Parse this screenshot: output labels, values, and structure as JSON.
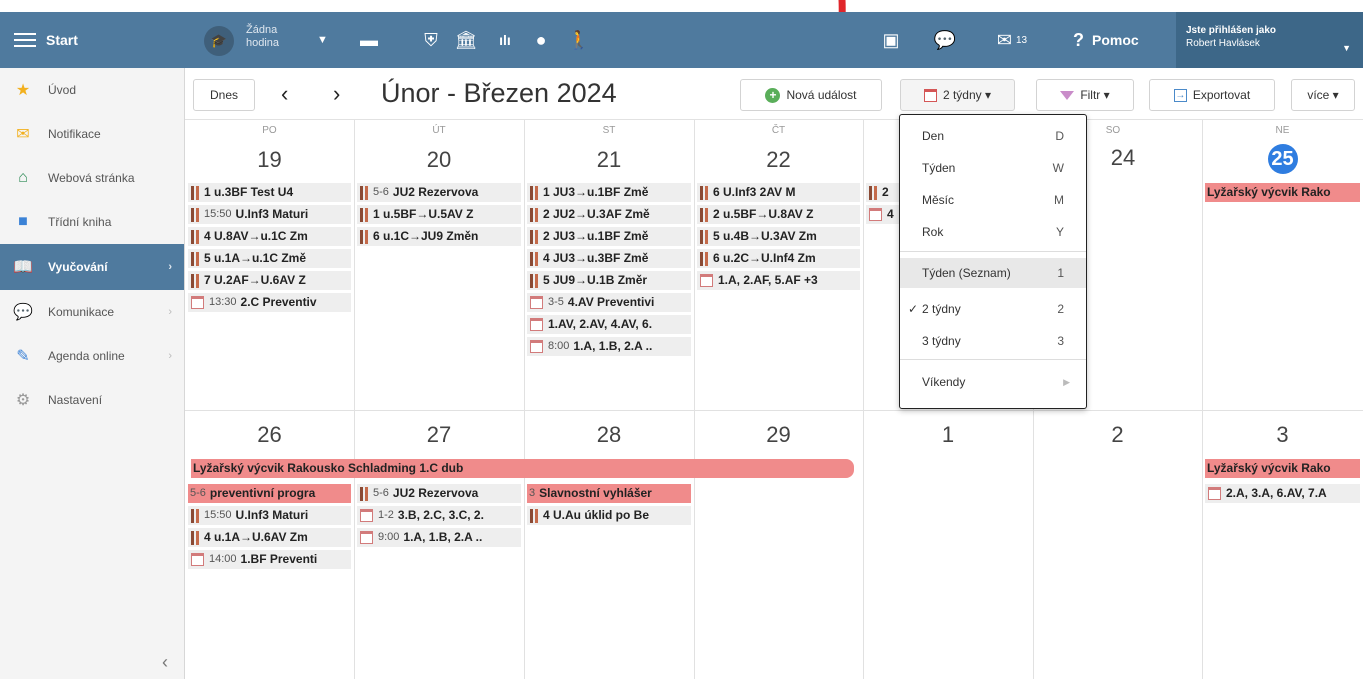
{
  "topbar": {
    "start_label": "Start",
    "hodina_line1": "Žádna",
    "hodina_line2": "hodina",
    "envelope_count": "13",
    "help_label": "Pomoc",
    "user_prefix": "Jste přihlášen jako",
    "user_name": "Robert Havlásek"
  },
  "sidebar": {
    "items": [
      {
        "label": "Úvod",
        "icon": "star-icon",
        "color": "#f2b01e"
      },
      {
        "label": "Notifikace",
        "icon": "envelope-icon",
        "color": "#f2b01e"
      },
      {
        "label": "Webová stránka",
        "icon": "home-icon",
        "color": "#2e8b57"
      },
      {
        "label": "Třídní kniha",
        "icon": "book-icon",
        "color": "#3b82d6"
      },
      {
        "label": "Vyučování",
        "icon": "open-book-icon",
        "color": "#ffffff"
      },
      {
        "label": "Komunikace",
        "icon": "chat-icon",
        "color": "#d9443a"
      },
      {
        "label": "Agenda online",
        "icon": "pen-icon",
        "color": "#3b82d6"
      },
      {
        "label": "Nastavení",
        "icon": "gear-icon",
        "color": "#999999"
      }
    ]
  },
  "toolbar": {
    "today": "Dnes",
    "prev": "‹",
    "next": "›",
    "period": "Únor - Březen 2024",
    "new_event": "Nová událost",
    "view": "2 týdny ▾",
    "filter": "Filtr ▾",
    "export": "Exportovat",
    "more": "více ▾"
  },
  "calendar": {
    "weekdays": [
      "PO",
      "ÚT",
      "ST",
      "ČT",
      "",
      "SO",
      "NE"
    ],
    "week1": [
      "19",
      "20",
      "21",
      "22",
      "",
      "24",
      "25"
    ],
    "week2": [
      "26",
      "27",
      "28",
      "29",
      "1",
      "2",
      "3"
    ],
    "events": {
      "w1d1": [
        {
          "m": "bar",
          "t": "",
          "x": "1 u.3BF Test U4"
        },
        {
          "m": "bar",
          "t": "15:50",
          "x": "U.Inf3 Maturi"
        },
        {
          "m": "bar",
          "t": "",
          "x": "4 U.8AV→u.1C Zm"
        },
        {
          "m": "bar",
          "t": "",
          "x": "5 u.1A→u.1C Změ"
        },
        {
          "m": "bar",
          "t": "",
          "x": "7 U.2AF→U.6AV Z"
        },
        {
          "m": "cal",
          "t": "13:30",
          "x": "2.C Preventiv"
        }
      ],
      "w1d2": [
        {
          "m": "bar",
          "t": "5-6",
          "x": "JU2 Rezervova"
        },
        {
          "m": "bar",
          "t": "",
          "x": "1 u.5BF→U.5AV Z"
        },
        {
          "m": "bar",
          "t": "",
          "x": "6 u.1C→JU9 Změn"
        }
      ],
      "w1d3": [
        {
          "m": "bar",
          "t": "",
          "x": "1 JU3→u.1BF Změ"
        },
        {
          "m": "bar",
          "t": "",
          "x": "2 JU2→U.3AF Změ"
        },
        {
          "m": "bar",
          "t": "",
          "x": "2 JU3→u.1BF Změ"
        },
        {
          "m": "bar",
          "t": "",
          "x": "4 JU3→u.3BF Změ"
        },
        {
          "m": "bar",
          "t": "",
          "x": "5 JU9→U.1B Změr"
        },
        {
          "m": "cal",
          "t": "3-5",
          "x": "4.AV Preventivi"
        },
        {
          "m": "cal",
          "t": "",
          "x": "1.AV, 2.AV, 4.AV, 6."
        },
        {
          "m": "cal",
          "t": "8:00",
          "x": "1.A, 1.B, 2.A .."
        }
      ],
      "w1d4": [
        {
          "m": "bar",
          "t": "",
          "x": "6 U.Inf3 2AV M"
        },
        {
          "m": "bar",
          "t": "",
          "x": "2 u.5BF→U.8AV Z"
        },
        {
          "m": "bar",
          "t": "",
          "x": "5 u.4B→U.3AV Zm"
        },
        {
          "m": "bar",
          "t": "",
          "x": "6 u.2C→U.Inf4 Zm"
        },
        {
          "m": "cal",
          "t": "",
          "x": "1.A, 2.AF, 5.AF +3"
        }
      ],
      "w1d5": [
        {
          "m": "bar",
          "t": "",
          "x": "2"
        },
        {
          "m": "cal",
          "t": "",
          "x": "4"
        }
      ],
      "w1d7": [
        {
          "m": "red",
          "t": "",
          "x": "Lyžařský výcvik Rako"
        }
      ],
      "w2span": "Lyžařský výcvik Rakousko Schladming 1.C dub",
      "w2d1": [
        {
          "m": "red",
          "t": "5-6",
          "x": "preventivní progra"
        },
        {
          "m": "bar",
          "t": "15:50",
          "x": "U.Inf3 Maturi"
        },
        {
          "m": "bar",
          "t": "",
          "x": "4 u.1A→U.6AV Zm"
        },
        {
          "m": "cal",
          "t": "14:00",
          "x": "1.BF Preventi"
        }
      ],
      "w2d2": [
        {
          "m": "bar",
          "t": "5-6",
          "x": "JU2 Rezervova"
        },
        {
          "m": "cal",
          "t": "1-2",
          "x": "3.B, 2.C, 3.C, 2."
        },
        {
          "m": "cal",
          "t": "9:00",
          "x": "1.A, 1.B, 2.A .."
        }
      ],
      "w2d3": [
        {
          "m": "red",
          "t": "3",
          "x": "Slavnostní vyhlášer"
        },
        {
          "m": "bar",
          "t": "",
          "x": "4 U.Au úklid po Be"
        }
      ],
      "w2d7": [
        {
          "m": "red",
          "t": "",
          "x": "Lyžařský výcvik Rako"
        },
        {
          "m": "cal",
          "t": "",
          "x": "2.A, 3.A, 6.AV, 7.A"
        }
      ]
    }
  },
  "dropdown": {
    "items": [
      {
        "label": "Den",
        "key": "D"
      },
      {
        "label": "Týden",
        "key": "W"
      },
      {
        "label": "Měsíc",
        "key": "M"
      },
      {
        "label": "Rok",
        "key": "Y"
      },
      {
        "label": "Týden (Seznam)",
        "key": "1"
      },
      {
        "label": "2 týdny",
        "key": "2",
        "check": "✓"
      },
      {
        "label": "3 týdny",
        "key": "3"
      },
      {
        "label": "Víkendy",
        "key": "▶"
      }
    ]
  },
  "colors": {
    "header": "#4f7a9e",
    "accent_red": "#f08b8b",
    "today": "#2f7de0",
    "annotation_arrow": "#e0262b"
  }
}
